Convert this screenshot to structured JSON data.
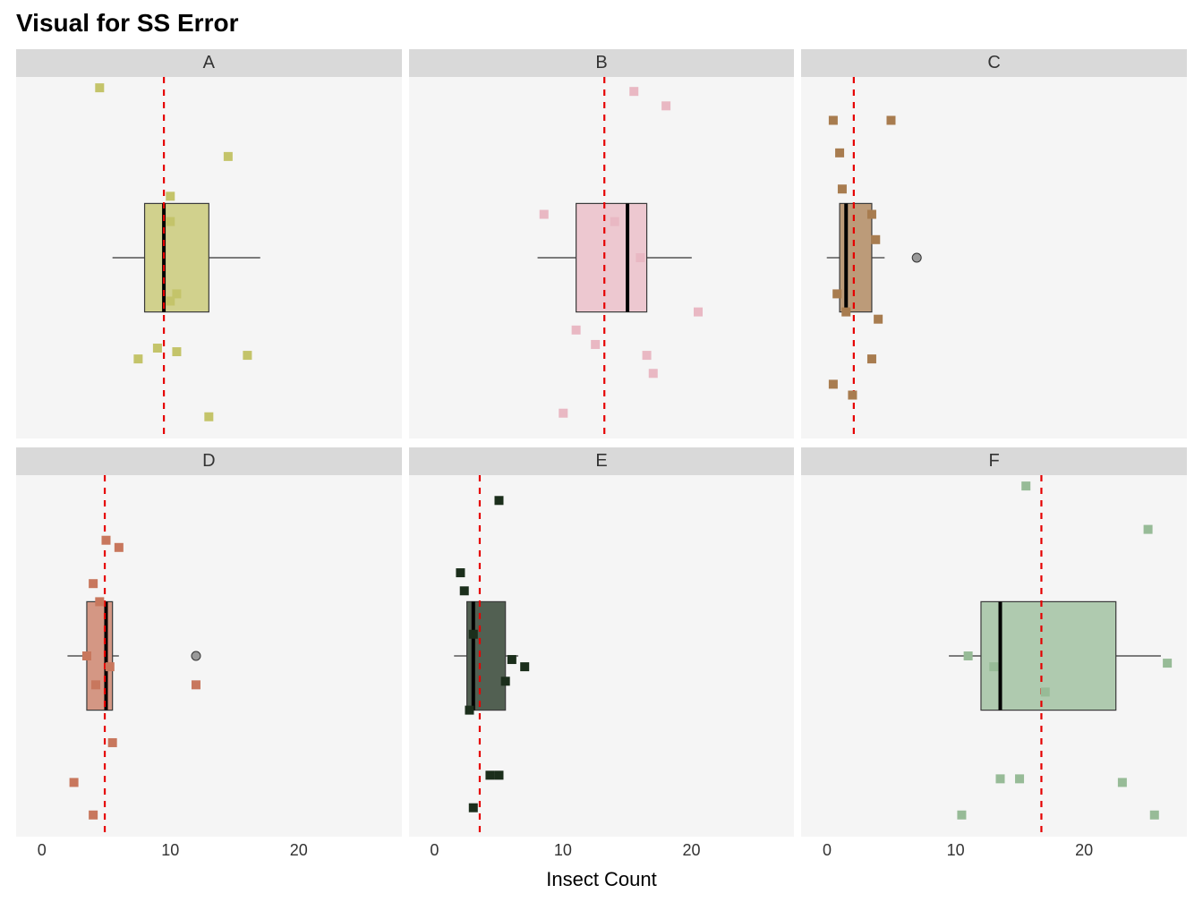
{
  "chart_data": {
    "type": "boxplot-facets",
    "title": "Visual for SS Error",
    "xlabel": "Insect Count",
    "x_ticks": [
      0,
      10,
      20
    ],
    "x_range": [
      -2,
      28
    ],
    "y_range": [
      0,
      1
    ],
    "box_y": [
      0.35,
      0.65
    ],
    "facets": [
      {
        "label": "A",
        "color": "#c4c46a",
        "group_mean": 9.5,
        "box": {
          "q1": 8,
          "median": 9.5,
          "q3": 13,
          "whisker_low": 5.5,
          "whisker_high": 17
        },
        "outliers": [],
        "points": [
          {
            "x": 4.5,
            "y": 0.97
          },
          {
            "x": 10,
            "y": 0.67
          },
          {
            "x": 14.5,
            "y": 0.78
          },
          {
            "x": 10.5,
            "y": 0.4
          },
          {
            "x": 10,
            "y": 0.38
          },
          {
            "x": 7.5,
            "y": 0.22
          },
          {
            "x": 9,
            "y": 0.25
          },
          {
            "x": 10.5,
            "y": 0.24
          },
          {
            "x": 16,
            "y": 0.23
          },
          {
            "x": 13,
            "y": 0.06
          },
          {
            "x": 10,
            "y": 0.6
          }
        ]
      },
      {
        "label": "B",
        "color": "#e9b8c3",
        "group_mean": 13.2,
        "box": {
          "q1": 11,
          "median": 15,
          "q3": 16.5,
          "whisker_low": 8,
          "whisker_high": 20
        },
        "outliers": [],
        "points": [
          {
            "x": 15.5,
            "y": 0.96
          },
          {
            "x": 18,
            "y": 0.92
          },
          {
            "x": 8.5,
            "y": 0.62
          },
          {
            "x": 16,
            "y": 0.5
          },
          {
            "x": 20.5,
            "y": 0.35
          },
          {
            "x": 12.5,
            "y": 0.26
          },
          {
            "x": 16.5,
            "y": 0.23
          },
          {
            "x": 17,
            "y": 0.18
          },
          {
            "x": 10,
            "y": 0.07
          },
          {
            "x": 11,
            "y": 0.3
          },
          {
            "x": 14,
            "y": 0.6
          }
        ]
      },
      {
        "label": "C",
        "color": "#a87c4f",
        "group_mean": 2.1,
        "box": {
          "q1": 1,
          "median": 1.5,
          "q3": 3.5,
          "whisker_low": 0,
          "whisker_high": 4.5
        },
        "outliers": [
          7
        ],
        "points": [
          {
            "x": 0.5,
            "y": 0.88
          },
          {
            "x": 5,
            "y": 0.88
          },
          {
            "x": 1,
            "y": 0.79
          },
          {
            "x": 1.2,
            "y": 0.69
          },
          {
            "x": 3.5,
            "y": 0.62
          },
          {
            "x": 3.8,
            "y": 0.55
          },
          {
            "x": 0.8,
            "y": 0.4
          },
          {
            "x": 1.5,
            "y": 0.35
          },
          {
            "x": 4,
            "y": 0.33
          },
          {
            "x": 3.5,
            "y": 0.22
          },
          {
            "x": 0.5,
            "y": 0.15
          },
          {
            "x": 2,
            "y": 0.12
          }
        ]
      },
      {
        "label": "D",
        "color": "#c8775d",
        "group_mean": 4.9,
        "box": {
          "q1": 3.5,
          "median": 5,
          "q3": 5.5,
          "whisker_low": 2,
          "whisker_high": 6
        },
        "outliers": [
          12
        ],
        "points": [
          {
            "x": 5,
            "y": 0.82
          },
          {
            "x": 6,
            "y": 0.8
          },
          {
            "x": 4,
            "y": 0.7
          },
          {
            "x": 4.5,
            "y": 0.65
          },
          {
            "x": 3.5,
            "y": 0.5
          },
          {
            "x": 5.3,
            "y": 0.47
          },
          {
            "x": 4.2,
            "y": 0.42
          },
          {
            "x": 5.5,
            "y": 0.26
          },
          {
            "x": 2.5,
            "y": 0.15
          },
          {
            "x": 4,
            "y": 0.06
          },
          {
            "x": 12,
            "y": 0.42
          }
        ]
      },
      {
        "label": "E",
        "color": "#1b2e1b",
        "group_mean": 3.5,
        "box": {
          "q1": 2.5,
          "median": 3,
          "q3": 5.5,
          "whisker_low": 1.5,
          "whisker_high": 6.5
        },
        "outliers": [],
        "points": [
          {
            "x": 5,
            "y": 0.93
          },
          {
            "x": 2,
            "y": 0.73
          },
          {
            "x": 2.3,
            "y": 0.68
          },
          {
            "x": 3,
            "y": 0.56
          },
          {
            "x": 6,
            "y": 0.49
          },
          {
            "x": 7,
            "y": 0.47
          },
          {
            "x": 5.5,
            "y": 0.43
          },
          {
            "x": 2.7,
            "y": 0.35
          },
          {
            "x": 4.3,
            "y": 0.17
          },
          {
            "x": 5,
            "y": 0.17
          },
          {
            "x": 3,
            "y": 0.08
          }
        ]
      },
      {
        "label": "F",
        "color": "#97bb97",
        "group_mean": 16.7,
        "box": {
          "q1": 12,
          "median": 13.5,
          "q3": 22.5,
          "whisker_low": 9.5,
          "whisker_high": 26
        },
        "outliers": [],
        "points": [
          {
            "x": 15.5,
            "y": 0.97
          },
          {
            "x": 25,
            "y": 0.85
          },
          {
            "x": 11,
            "y": 0.5
          },
          {
            "x": 13,
            "y": 0.47
          },
          {
            "x": 26.5,
            "y": 0.48
          },
          {
            "x": 13.5,
            "y": 0.16
          },
          {
            "x": 15,
            "y": 0.16
          },
          {
            "x": 23,
            "y": 0.15
          },
          {
            "x": 10.5,
            "y": 0.06
          },
          {
            "x": 25.5,
            "y": 0.06
          },
          {
            "x": 17,
            "y": 0.4
          }
        ]
      }
    ]
  }
}
